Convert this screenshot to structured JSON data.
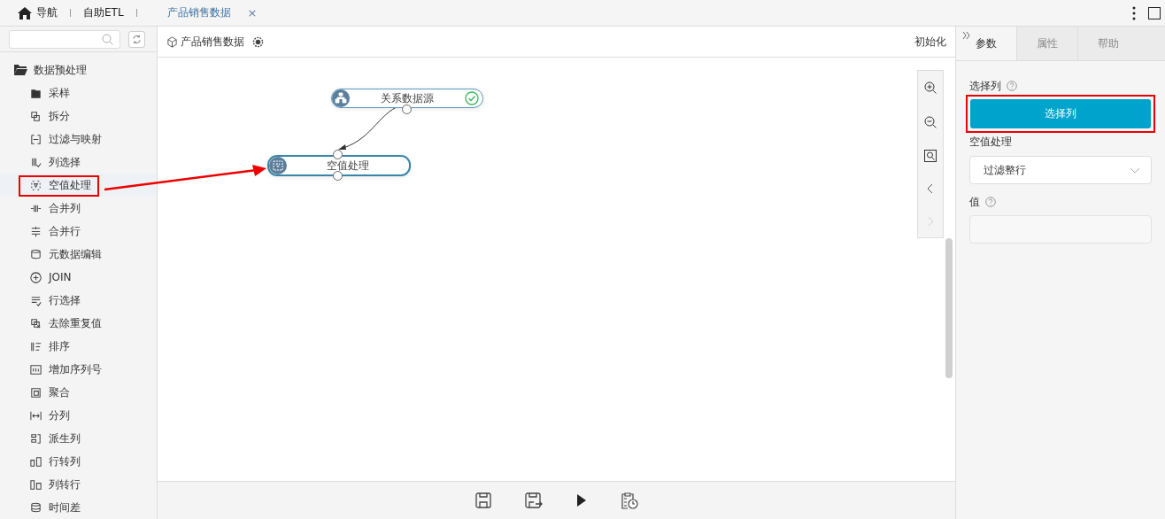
{
  "top_tabs": [
    {
      "label": "导航",
      "selected": false,
      "kind": "home"
    },
    {
      "label": "自助ETL",
      "selected": false,
      "kind": "plain"
    },
    {
      "label": "产品销售数据",
      "selected": true,
      "kind": "closable",
      "close": "×"
    }
  ],
  "sidebar": {
    "group": {
      "label": "数据预处理",
      "expanded": true,
      "children": [
        {
          "label": "采样",
          "selected": false,
          "annotated": false
        },
        {
          "label": "拆分",
          "selected": false,
          "annotated": false
        },
        {
          "label": "过滤与映射",
          "selected": false,
          "annotated": false
        },
        {
          "label": "列选择",
          "selected": false,
          "annotated": false
        },
        {
          "label": "空值处理",
          "selected": true,
          "annotated": true
        },
        {
          "label": "合并列",
          "selected": false,
          "annotated": false
        },
        {
          "label": "合并行",
          "selected": false,
          "annotated": false
        },
        {
          "label": "元数据编辑",
          "selected": false,
          "annotated": false
        },
        {
          "label": "JOIN",
          "selected": false,
          "annotated": false
        },
        {
          "label": "行选择",
          "selected": false,
          "annotated": false
        },
        {
          "label": "去除重复值",
          "selected": false,
          "annotated": false
        },
        {
          "label": "排序",
          "selected": false,
          "annotated": false
        },
        {
          "label": "增加序列号",
          "selected": false,
          "annotated": false
        },
        {
          "label": "聚合",
          "selected": false,
          "annotated": false
        },
        {
          "label": "分列",
          "selected": false,
          "annotated": false
        },
        {
          "label": "派生列",
          "selected": false,
          "annotated": false
        },
        {
          "label": "行转列",
          "selected": false,
          "annotated": false
        },
        {
          "label": "列转行",
          "selected": false,
          "annotated": false
        },
        {
          "label": "时间差",
          "selected": false,
          "annotated": false
        }
      ]
    }
  },
  "canvas": {
    "title": "产品销售数据",
    "init_label": "初始化",
    "nodes": [
      {
        "label": "关系数据源",
        "kind": "source",
        "validated": true,
        "selected": false
      },
      {
        "label": "空值处理",
        "kind": "null",
        "validated": false,
        "selected": true
      }
    ],
    "next_disabled": true
  },
  "panel": {
    "tabs": [
      {
        "label": "参数",
        "selected": true
      },
      {
        "label": "属性",
        "selected": false
      },
      {
        "label": "帮助",
        "selected": false
      }
    ],
    "column_label": "选择列",
    "column_button": "选择列",
    "button_annotated": true,
    "null_label": "空值处理",
    "null_value": "过滤整行",
    "value_label": "值"
  }
}
